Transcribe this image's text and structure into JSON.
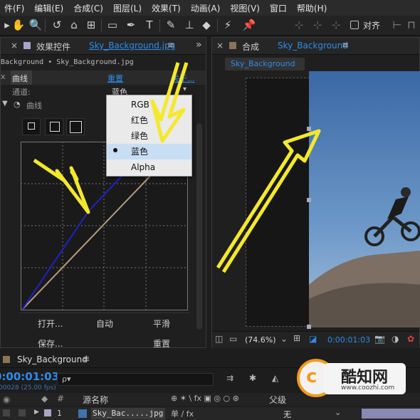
{
  "menubar": {
    "items": [
      "件(F)",
      "编辑(E)",
      "合成(C)",
      "图层(L)",
      "效果(T)",
      "动画(A)",
      "视图(V)",
      "窗口",
      "帮助(H)"
    ]
  },
  "toolbar": {
    "align_label": "对齐"
  },
  "effect_panel": {
    "close": "×",
    "title": "效果控件 ",
    "file": "Sky_Background.jpg",
    "menu": "≡",
    "collapse": "»",
    "breadcrumb": "Background • Sky_Background.jpg",
    "fx": "x",
    "effect_name_tab": "曲线",
    "reset_label": "重置",
    "about_label": "关于...",
    "channel_label": "通道:",
    "channel_value": "蓝色",
    "curves_label": "曲线",
    "btn_open": "打开...",
    "btn_auto": "自动",
    "btn_smooth": "平滑",
    "btn_save": "保存...",
    "btn_reset": "重置"
  },
  "channel_dropdown": {
    "options": [
      "RGB",
      "红色",
      "绿色",
      "蓝色",
      "Alpha"
    ],
    "selected": "蓝色"
  },
  "comp_panel": {
    "close": "×",
    "title": "合成 ",
    "comp_name": "Sky_Background",
    "menu": "≡",
    "tab_label": "Sky_Background",
    "zoom": "(74.6%)",
    "timecode": "0:00:01:03"
  },
  "timeline": {
    "close": "×",
    "comp_name": "Sky_Background",
    "menu": "≡",
    "timecode": "0:00:01:03",
    "frames": "00028 (25.00 fps)",
    "search_placeholder": "ρ▾",
    "col_source": "源名称",
    "col_parent": "父级",
    "layer_index": "1",
    "layer_name": "Sky_Bac.....jpg",
    "parent_value": "无"
  },
  "watermark": {
    "brand": "酷知网",
    "url": "www.coozhi.com"
  },
  "colors": {
    "accent": "#2d8ceb",
    "arrow": "#f4e82c",
    "curve_blue": "#1f22c8",
    "curve_diag": "#b49a7a"
  }
}
